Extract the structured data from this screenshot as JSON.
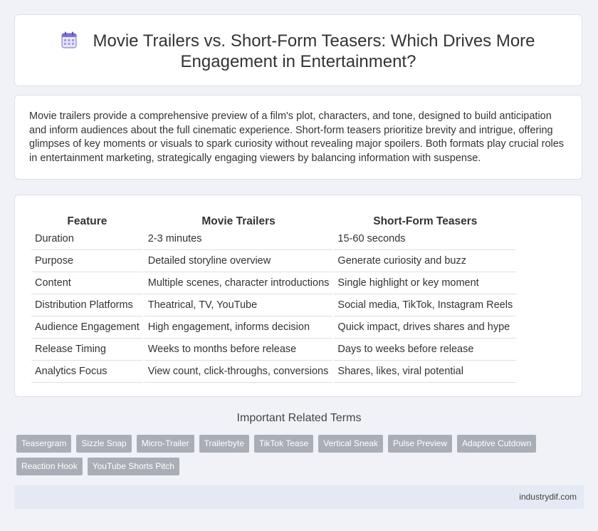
{
  "header": {
    "title": "Movie Trailers vs. Short-Form Teasers: Which Drives More Engagement in Entertainment?",
    "icon": "calendar-icon"
  },
  "intro": {
    "text": "Movie trailers provide a comprehensive preview of a film's plot, characters, and tone, designed to build anticipation and inform audiences about the full cinematic experience. Short-form teasers prioritize brevity and intrigue, offering glimpses of key moments or visuals to spark curiosity without revealing major spoilers. Both formats play crucial roles in entertainment marketing, strategically engaging viewers by balancing information with suspense."
  },
  "table": {
    "headers": [
      "Feature",
      "Movie Trailers",
      "Short-Form Teasers"
    ],
    "rows": [
      [
        "Duration",
        "2-3 minutes",
        "15-60 seconds"
      ],
      [
        "Purpose",
        "Detailed storyline overview",
        "Generate curiosity and buzz"
      ],
      [
        "Content",
        "Multiple scenes, character introductions",
        "Single highlight or key moment"
      ],
      [
        "Distribution Platforms",
        "Theatrical, TV, YouTube",
        "Social media, TikTok, Instagram Reels"
      ],
      [
        "Audience Engagement",
        "High engagement, informs decision",
        "Quick impact, drives shares and hype"
      ],
      [
        "Release Timing",
        "Weeks to months before release",
        "Days to weeks before release"
      ],
      [
        "Analytics Focus",
        "View count, click-throughs, conversions",
        "Shares, likes, viral potential"
      ]
    ]
  },
  "related": {
    "title": "Important Related Terms",
    "tags": [
      "Teasergram",
      "Sizzle Snap",
      "Micro-Trailer",
      "Trailerbyte",
      "TikTok Tease",
      "Vertical Sneak",
      "Pulse Preview",
      "Adaptive Cutdown",
      "Reaction Hook",
      "YouTube Shorts Pitch"
    ]
  },
  "footer": {
    "text": "industrydif.com"
  },
  "colors": {
    "background": "#f0f2f7",
    "tag_bg": "#a9aeb6",
    "footer_bg": "#e4e9f4",
    "icon_accent": "#7b6fd6"
  }
}
